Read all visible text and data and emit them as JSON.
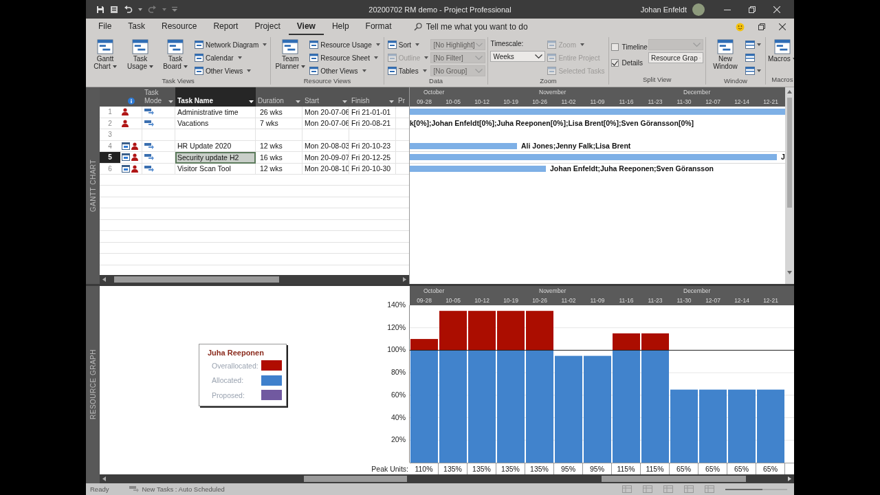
{
  "window": {
    "title": "20200702 RM demo  -  Project Professional",
    "user": "Johan Enfeldt"
  },
  "menu_tabs": [
    {
      "label": "File",
      "selected": false
    },
    {
      "label": "Task",
      "selected": false
    },
    {
      "label": "Resource",
      "selected": false
    },
    {
      "label": "Report",
      "selected": false
    },
    {
      "label": "Project",
      "selected": false
    },
    {
      "label": "View",
      "selected": true
    },
    {
      "label": "Help",
      "selected": false
    },
    {
      "label": "Format",
      "selected": false
    }
  ],
  "tell_me": {
    "placeholder": "Tell me what you want to do"
  },
  "ribbon": [
    {
      "label": "Task Views",
      "columns": [
        [
          {
            "kind": "large",
            "label": "Gantt Chart",
            "menu": true,
            "disabled": false
          }
        ],
        [
          {
            "kind": "large",
            "label": "Task Usage",
            "menu": true,
            "disabled": false
          }
        ],
        [
          {
            "kind": "large",
            "label": "Task Board",
            "menu": true,
            "disabled": false
          }
        ],
        [
          {
            "kind": "small",
            "label": "Network Diagram",
            "menu": true,
            "disabled": false
          },
          {
            "kind": "small",
            "label": "Calendar",
            "menu": true,
            "disabled": false
          },
          {
            "kind": "small",
            "label": "Other Views",
            "menu": true,
            "disabled": false
          }
        ]
      ]
    },
    {
      "label": "Resource Views",
      "columns": [
        [
          {
            "kind": "large",
            "label": "Team Planner",
            "menu": true,
            "disabled": false
          }
        ],
        [
          {
            "kind": "small",
            "label": "Resource Usage",
            "menu": true,
            "disabled": false
          },
          {
            "kind": "small",
            "label": "Resource Sheet",
            "menu": true,
            "disabled": false
          },
          {
            "kind": "small",
            "label": "Other Views",
            "menu": true,
            "disabled": false
          }
        ]
      ]
    },
    {
      "label": "Data",
      "columns": [
        [
          {
            "kind": "small",
            "label": "Sort",
            "menu": true,
            "disabled": false
          },
          {
            "kind": "small",
            "label": "Outline",
            "menu": true,
            "disabled": true
          },
          {
            "kind": "small",
            "label": "Tables",
            "menu": true,
            "disabled": false
          }
        ],
        [
          {
            "kind": "combo",
            "value": "[No Highlight]",
            "disabled": true
          },
          {
            "kind": "combo",
            "value": "[No Filter]",
            "disabled": true
          },
          {
            "kind": "combo",
            "value": "[No Group]",
            "disabled": true
          }
        ]
      ]
    },
    {
      "label": "Zoom",
      "columns": [
        [
          {
            "kind": "label",
            "label": "Timescale:"
          },
          {
            "kind": "combo",
            "value": "Weeks",
            "disabled": false
          }
        ],
        [
          {
            "kind": "small",
            "label": "Zoom",
            "menu": true,
            "disabled": true
          },
          {
            "kind": "small",
            "label": "Entire Project",
            "menu": false,
            "disabled": true
          },
          {
            "kind": "small",
            "label": "Selected Tasks",
            "menu": false,
            "disabled": true
          }
        ]
      ]
    },
    {
      "label": "Split View",
      "columns": [
        [
          {
            "kind": "checkbox",
            "label": "Timeline",
            "checked": false
          },
          {
            "kind": "checkbox",
            "label": "Details",
            "checked": true
          }
        ],
        [
          {
            "kind": "combo",
            "disabled": true
          },
          {
            "kind": "combo",
            "value": "Resource Grap",
            "disabled": false
          }
        ]
      ]
    },
    {
      "label": "Window",
      "columns": [
        [
          {
            "kind": "large",
            "label": "New Window",
            "menu": false,
            "disabled": false
          }
        ],
        [
          {
            "kind": "icon",
            "menu": true
          },
          {
            "kind": "icon",
            "menu": false
          },
          {
            "kind": "icon",
            "menu": true
          }
        ]
      ]
    },
    {
      "label": "Macros",
      "columns": [
        [
          {
            "kind": "large",
            "label": "Macros",
            "menu": true,
            "disabled": false
          }
        ]
      ]
    }
  ],
  "gantt": {
    "side_label": "GANTT CHART",
    "columns": [
      {
        "kind": "indicators",
        "selected": false,
        "menu": false
      },
      {
        "label": "Task Mode",
        "selected": false,
        "menu": true
      },
      {
        "label": "Task Name",
        "selected": true,
        "menu": true
      },
      {
        "label": "Duration",
        "selected": false,
        "menu": true
      },
      {
        "label": "Start",
        "selected": false,
        "menu": true
      },
      {
        "label": "Finish",
        "selected": false,
        "menu": true
      },
      {
        "label": "Pr",
        "selected": false,
        "menu": false
      }
    ],
    "rows": [
      {
        "id": "1",
        "has_calendar": false,
        "name": "Administrative time",
        "duration": "26 wks",
        "start": "Mon 20-07-06",
        "finish": "Fri 21-01-01",
        "selected": false
      },
      {
        "id": "2",
        "has_calendar": false,
        "name": "Vacations",
        "duration": "7 wks",
        "start": "Mon 20-07-06",
        "finish": "Fri 20-08-21",
        "selected": false,
        "resources": "k[0%];Johan Enfeldt[0%];Juha Reeponen[0%];Lisa Brent[0%];Sven Göransson[0%]"
      },
      {
        "id": "3",
        "selected": false
      },
      {
        "id": "4",
        "has_calendar": true,
        "name": "HR Update 2020",
        "duration": "12 wks",
        "start": "Mon 20-08-03",
        "finish": "Fri 20-10-23",
        "selected": false,
        "resources": "Ali Jones;Jenny Falk;Lisa Brent"
      },
      {
        "id": "5",
        "has_calendar": true,
        "name": "Security update H2",
        "duration": "16 wks",
        "start": "Mon 20-09-07",
        "finish": "Fri 20-12-25",
        "selected": true,
        "resources": "J"
      },
      {
        "id": "6",
        "has_calendar": true,
        "name": "Visitor Scan Tool",
        "duration": "12 wks",
        "start": "Mon 20-08-10",
        "finish": "Fri 20-10-30",
        "selected": false,
        "resources": "Johan Enfeldt;Juha Reeponen;Sven Göransson"
      }
    ],
    "timescale": {
      "months": [
        {
          "label": "October"
        },
        {
          "label": "November"
        },
        {
          "label": "December"
        }
      ],
      "weeks": [
        "09-28",
        "10-05",
        "10-12",
        "10-19",
        "10-26",
        "11-02",
        "11-09",
        "11-16",
        "11-23",
        "11-30",
        "12-07",
        "12-14",
        "12-21"
      ]
    }
  },
  "resource_graph": {
    "side_label": "RESOURCE GRAPH",
    "legend": {
      "title": "Juha Reeponen",
      "items": [
        {
          "label": "Overallocated:",
          "color": "#b00c00"
        },
        {
          "label": "Allocated:",
          "color": "#3f80cc"
        },
        {
          "label": "Proposed:",
          "color": "#7159a0"
        }
      ]
    },
    "months": [
      {
        "label": "October"
      },
      {
        "label": "November"
      },
      {
        "label": "December"
      }
    ],
    "peak_label": "Peak Units:",
    "chart_data": {
      "type": "bar",
      "stacked": true,
      "grid": true,
      "ref_lines": [
        {
          "axis": "y",
          "value": 100
        }
      ],
      "categories": [
        "09-28",
        "10-05",
        "10-12",
        "10-19",
        "10-26",
        "11-02",
        "11-09",
        "11-16",
        "11-23",
        "11-30",
        "12-07",
        "12-14",
        "12-21"
      ],
      "series": [
        {
          "color": "#4183cc",
          "values": [
            100,
            100,
            100,
            100,
            100,
            95,
            95,
            100,
            100,
            65,
            65,
            65,
            65
          ]
        },
        {
          "color": "#ab0d00",
          "values": [
            10,
            35,
            35,
            35,
            35,
            0,
            0,
            15,
            15,
            0,
            0,
            0,
            0
          ]
        }
      ],
      "ylim": [
        0,
        140
      ],
      "yticks": [
        {
          "value": 20,
          "label": "20%"
        },
        {
          "value": 40,
          "label": "40%"
        },
        {
          "value": 60,
          "label": "60%"
        },
        {
          "value": 80,
          "label": "80%"
        },
        {
          "value": 100,
          "label": "100%"
        },
        {
          "value": 120,
          "label": "120%"
        },
        {
          "value": 140,
          "label": "140%"
        }
      ],
      "value_labels": [
        "110%",
        "135%",
        "135%",
        "135%",
        "135%",
        "95%",
        "95%",
        "115%",
        "115%",
        "65%",
        "65%",
        "65%",
        "65%"
      ]
    }
  },
  "status_bar": {
    "ready": "Ready",
    "new_tasks": "New Tasks : Auto Scheduled",
    "zoom": {
      "level": 0.6
    }
  }
}
